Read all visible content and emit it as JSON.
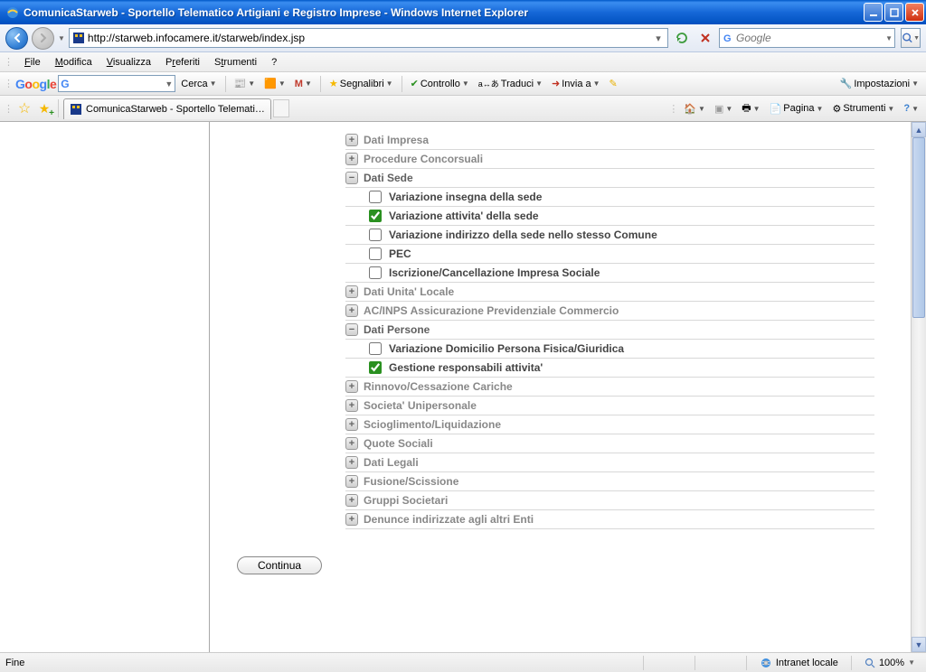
{
  "titlebar": {
    "title": "ComunicaStarweb - Sportello Telematico Artigiani e Registro Imprese - Windows Internet Explorer"
  },
  "nav": {
    "url": "http://starweb.infocamere.it/starweb/index.jsp",
    "search_placeholder": "Google"
  },
  "menubar": {
    "file": "File",
    "modifica": "Modifica",
    "visualizza": "Visualizza",
    "preferiti": "Preferiti",
    "strumenti": "Strumenti",
    "help": "?"
  },
  "gtoolbar": {
    "logo": "Google",
    "cerca": "Cerca",
    "segnalibri": "Segnalibri",
    "controllo": "Controllo",
    "traduci": "Traduci",
    "invia": "Invia a",
    "impostazioni": "Impostazioni"
  },
  "tab": {
    "label": "ComunicaStarweb - Sportello Telematico Artigiani e Re..."
  },
  "cmdbar": {
    "pagina": "Pagina",
    "strumenti": "Strumenti"
  },
  "sections": [
    {
      "label": "Dati Impresa",
      "expanded": false
    },
    {
      "label": "Procedure Concorsuali",
      "expanded": false
    },
    {
      "label": "Dati Sede",
      "expanded": true,
      "items": [
        {
          "label": "Variazione insegna della sede",
          "checked": false
        },
        {
          "label": "Variazione attivita' della sede",
          "checked": true
        },
        {
          "label": "Variazione indirizzo della sede nello stesso Comune",
          "checked": false
        },
        {
          "label": "PEC",
          "checked": false
        },
        {
          "label": "Iscrizione/Cancellazione Impresa Sociale",
          "checked": false
        }
      ]
    },
    {
      "label": "Dati Unita' Locale",
      "expanded": false
    },
    {
      "label": "AC/INPS Assicurazione Previdenziale Commercio",
      "expanded": false
    },
    {
      "label": "Dati Persone",
      "expanded": true,
      "items": [
        {
          "label": "Variazione Domicilio Persona Fisica/Giuridica",
          "checked": false
        },
        {
          "label": "Gestione responsabili attivita'",
          "checked": true
        }
      ]
    },
    {
      "label": "Rinnovo/Cessazione Cariche",
      "expanded": false
    },
    {
      "label": "Societa' Unipersonale",
      "expanded": false
    },
    {
      "label": "Scioglimento/Liquidazione",
      "expanded": false
    },
    {
      "label": "Quote Sociali",
      "expanded": false
    },
    {
      "label": "Dati Legali",
      "expanded": false
    },
    {
      "label": "Fusione/Scissione",
      "expanded": false
    },
    {
      "label": "Gruppi Societari",
      "expanded": false
    },
    {
      "label": "Denunce indirizzate agli altri Enti",
      "expanded": false
    }
  ],
  "buttons": {
    "continua": "Continua"
  },
  "status": {
    "left": "Fine",
    "zone": "Intranet locale",
    "zoom": "100%"
  }
}
